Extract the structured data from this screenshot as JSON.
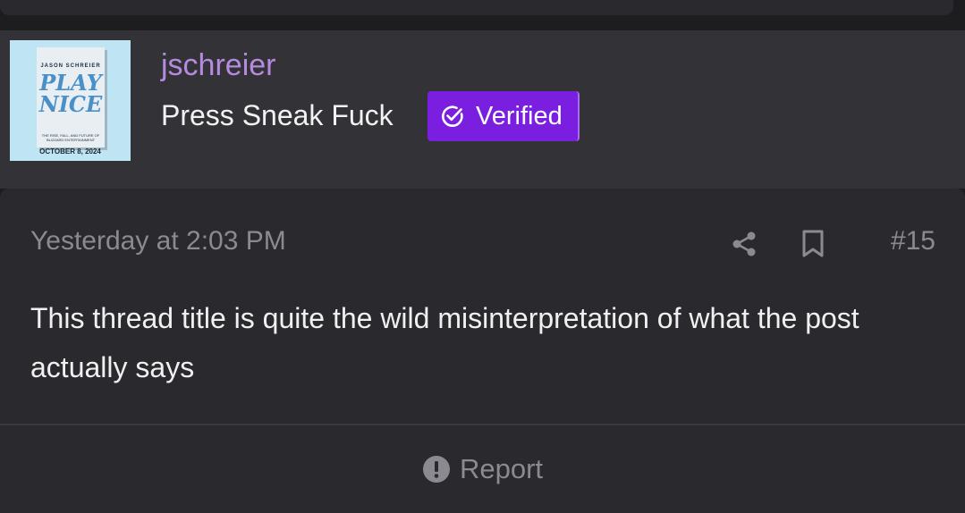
{
  "author": {
    "username": "jschreier",
    "user_title": "Press Sneak Fuck",
    "badge_label": "Verified",
    "avatar": {
      "book_author": "JASON SCHREIER",
      "book_title": "PLAY\nNICE",
      "book_subtitle": "THE RISE, FALL, AND FUTURE OF BLIZZARD ENTERTAINMENT",
      "date": "OCTOBER 8, 2024"
    }
  },
  "post": {
    "timestamp": "Yesterday at 2:03 PM",
    "number": "#15",
    "body": "This thread title is quite the wild misinterpretation of what the post actually says",
    "report_label": "Report"
  },
  "icons": {
    "share": "share-icon",
    "bookmark": "bookmark-icon",
    "report": "exclamation-circle-icon",
    "verified": "check-circle-icon"
  },
  "colors": {
    "username": "#b58be0",
    "badge": "#7a1ee0",
    "muted_text": "#8a8a90",
    "body_text": "#f0f0f0"
  }
}
